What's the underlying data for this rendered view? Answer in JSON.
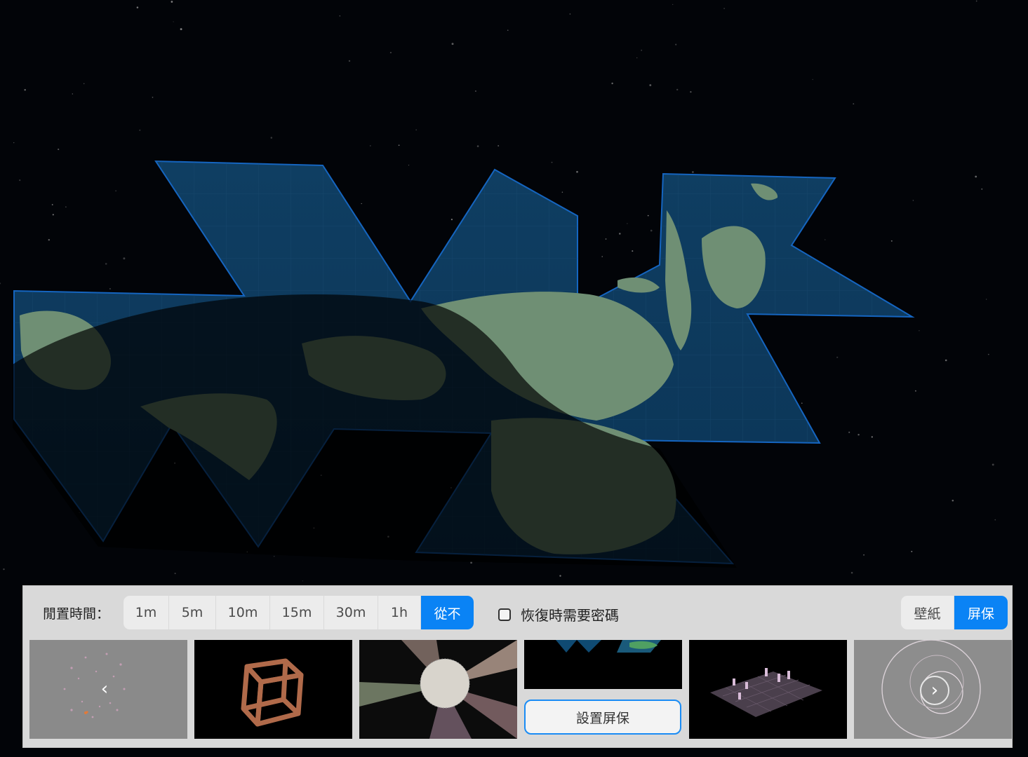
{
  "settings": {
    "idle_label": "閒置時間：",
    "time_options": [
      "1m",
      "5m",
      "10m",
      "15m",
      "30m",
      "1h",
      "從不"
    ],
    "selected_time": "從不",
    "password_label": "恢復時需要密碼",
    "password_checked": false,
    "mode_tabs": [
      "壁紙",
      "屏保"
    ],
    "selected_mode": "屏保"
  },
  "screensavers": {
    "set_button_label": "設置屏保",
    "prev_icon": "chevron-left-icon",
    "next_icon": "chevron-right-icon",
    "thumbnails": [
      "particles",
      "wireframe-cube",
      "sphere-light-beams",
      "dymaxion-map",
      "grid-pawns",
      "circles"
    ],
    "selected_index": 3
  },
  "colors": {
    "accent": "#0a83f5",
    "panel": "#d9d9d9",
    "map_ocean": "#0d3a5c",
    "map_land": "#6f8f74"
  }
}
